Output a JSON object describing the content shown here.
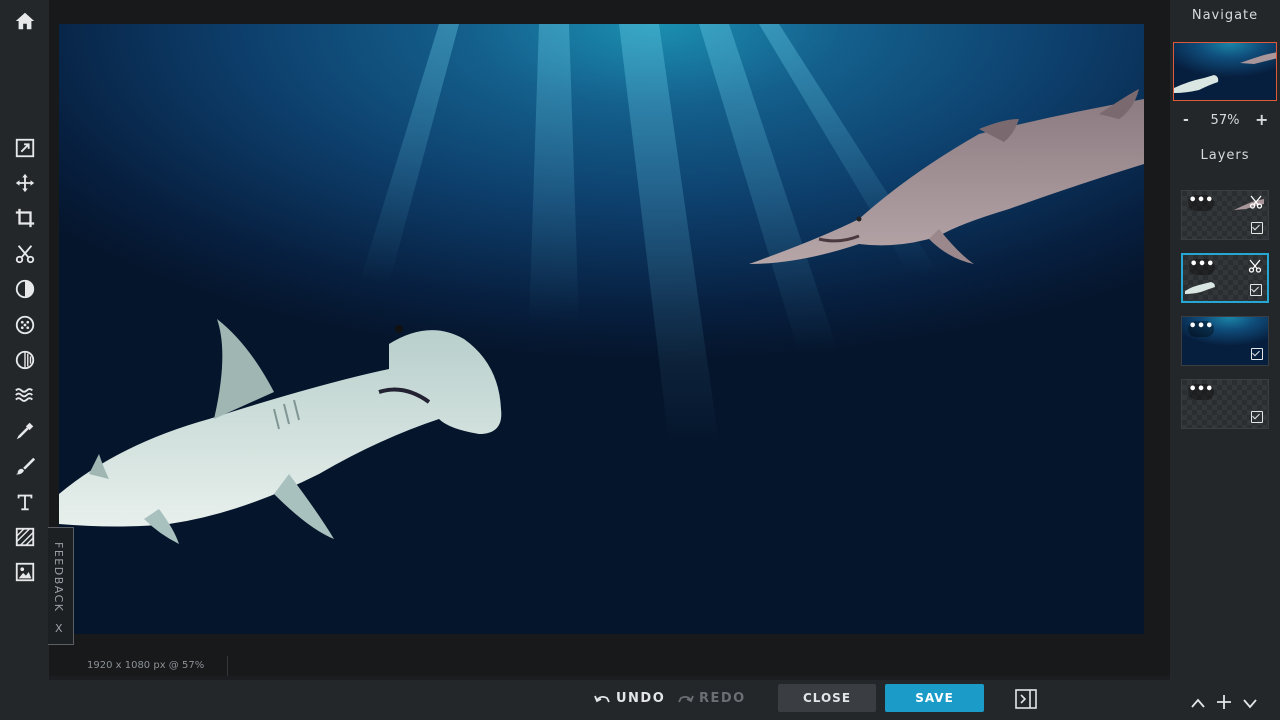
{
  "toolbar": {
    "tools": [
      "home-icon",
      "adjust-icon",
      "move-icon",
      "crop-icon",
      "cut-icon",
      "filter-icon",
      "effects-icon",
      "overlay-icon",
      "distort-icon",
      "dropper-icon",
      "brush-icon",
      "text-icon",
      "pattern-icon",
      "image-icon"
    ],
    "settings_icon": "gear-icon"
  },
  "canvas": {
    "status": "1920 x 1080 px @ 57%"
  },
  "feedback": {
    "label": "FEEDBACK",
    "close": "X"
  },
  "bottom": {
    "undo": "UNDO",
    "redo": "REDO",
    "close": "CLOSE",
    "save": "SAVE"
  },
  "right_panel": {
    "navigate_title": "Navigate",
    "zoom_minus": "-",
    "zoom_value": "57%",
    "zoom_plus": "+",
    "layers_title": "Layers",
    "layers": [
      {
        "dots": "•••",
        "visible": true,
        "selected": false
      },
      {
        "dots": "•••",
        "visible": true,
        "selected": true
      },
      {
        "dots": "•••",
        "visible": true,
        "selected": false
      },
      {
        "dots": "•••",
        "visible": true,
        "selected": false
      }
    ]
  },
  "colors": {
    "accent": "#1b9cc8",
    "selection": "#24a7d2",
    "nav_frame": "#e05a3a"
  }
}
